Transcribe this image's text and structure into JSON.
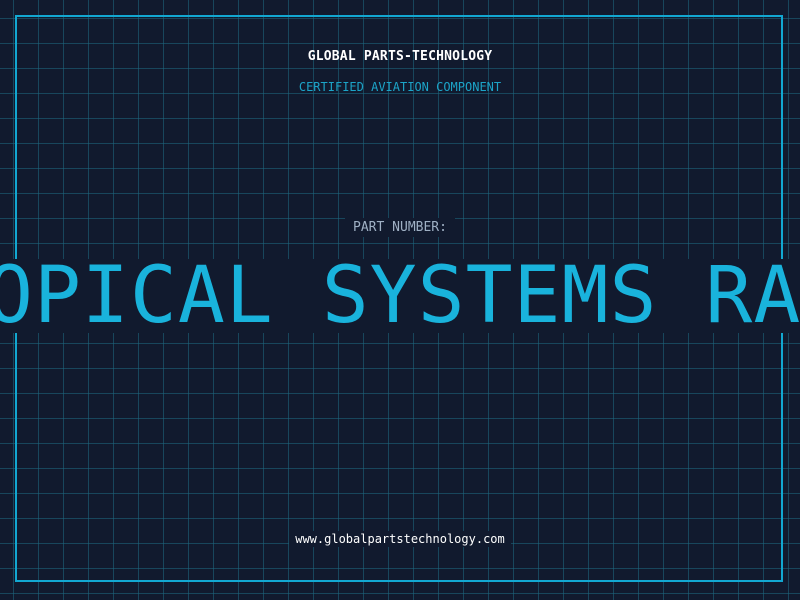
{
  "header": {
    "company": "GLOBAL PARTS-TECHNOLOGY",
    "tagline": "CERTIFIED AVIATION COMPONENT"
  },
  "part": {
    "label": "PART NUMBER:",
    "value": "OPICAL SYSTEMS RAD"
  },
  "footer": {
    "url": "www.globalpartstechnology.com"
  },
  "colors": {
    "background": "#111a2e",
    "grid": "#1e6982",
    "frame": "#12a8d2",
    "accent": "#19b3dc"
  }
}
